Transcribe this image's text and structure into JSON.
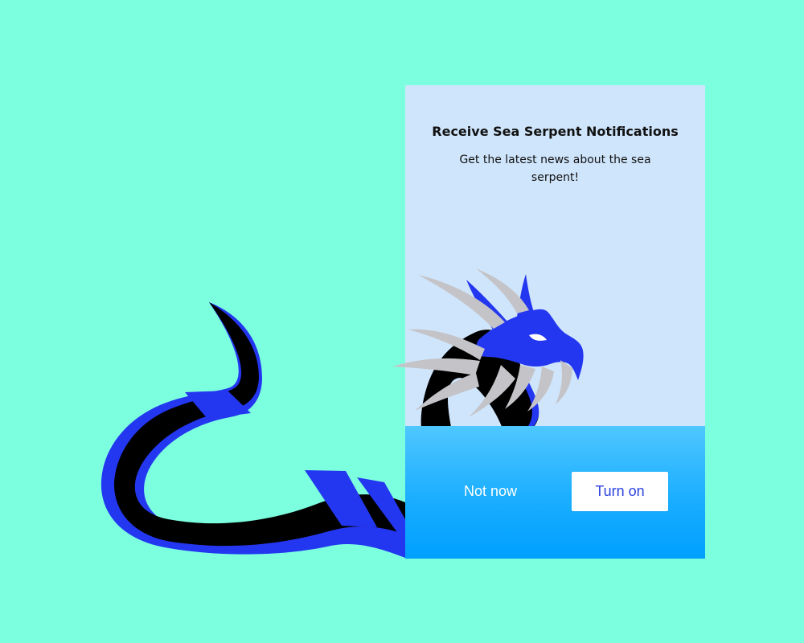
{
  "illustration": {
    "name": "sea-serpent-illustration",
    "colors": {
      "background": "#7cffdf",
      "serpent_body": "#000000",
      "serpent_accent": "#2437f0",
      "fins": "#c4c4c8"
    }
  },
  "dialog": {
    "title": "Receive Sea Serpent Notifications",
    "message": "Get the latest news about the sea serpent!",
    "colors": {
      "panel": "#cfe5fb",
      "action_top": "#4fc7ff",
      "action_bottom": "#009fff"
    },
    "buttons": {
      "secondary_label": "Not now",
      "primary_label": "Turn on"
    }
  }
}
